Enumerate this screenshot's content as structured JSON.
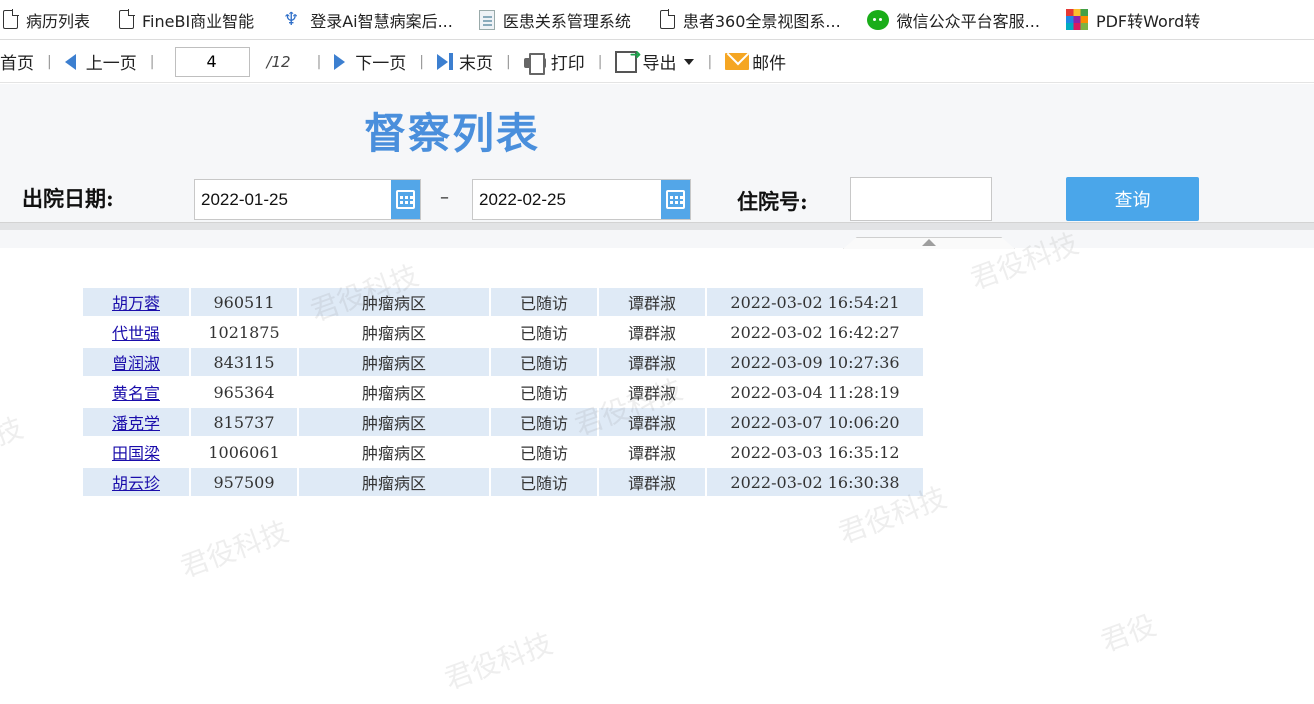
{
  "bookmarks": [
    {
      "label": "病历列表",
      "icon": "page-icon"
    },
    {
      "label": "FineBI商业智能",
      "icon": "page-icon"
    },
    {
      "label": "登录Ai智慧病案后...",
      "icon": "lotus-icon"
    },
    {
      "label": "医患关系管理系统",
      "icon": "doc-icon"
    },
    {
      "label": "患者360全景视图系...",
      "icon": "page-icon"
    },
    {
      "label": "微信公众平台客服...",
      "icon": "wechat-icon"
    },
    {
      "label": "PDF转Word转",
      "icon": "pdf-icon"
    }
  ],
  "toolbar": {
    "first": "首页",
    "prev": "上一页",
    "page_value": "4",
    "page_total": "/12",
    "next": "下一页",
    "last": "末页",
    "print": "打印",
    "export": "导出",
    "mail": "邮件"
  },
  "filter": {
    "title": "督察列表",
    "discharge_label": "出院日期:",
    "date_from": "2022-01-25",
    "date_sep": "–",
    "date_to": "2022-02-25",
    "admission_label": "住院号:",
    "admission_value": "",
    "query_label": "查询"
  },
  "table": {
    "rows": [
      [
        "胡万蓉",
        "960511",
        "肿瘤病区",
        "已随访",
        "谭群淑",
        "2022-03-02 16:54:21"
      ],
      [
        "代世强",
        "1021875",
        "肿瘤病区",
        "已随访",
        "谭群淑",
        "2022-03-02 16:42:27"
      ],
      [
        "曾润淑",
        "843115",
        "肿瘤病区",
        "已随访",
        "谭群淑",
        "2022-03-09 10:27:36"
      ],
      [
        "黄名宣",
        "965364",
        "肿瘤病区",
        "已随访",
        "谭群淑",
        "2022-03-04 11:28:19"
      ],
      [
        "潘克学",
        "815737",
        "肿瘤病区",
        "已随访",
        "谭群淑",
        "2022-03-07 10:06:20"
      ],
      [
        "田国梁",
        "1006061",
        "肿瘤病区",
        "已随访",
        "谭群淑",
        "2022-03-03 16:35:12"
      ],
      [
        "胡云珍",
        "957509",
        "肿瘤病区",
        "已随访",
        "谭群淑",
        "2022-03-02 16:30:38"
      ]
    ]
  },
  "watermarks": [
    "君役科技",
    "君役科技",
    "技",
    "君役科技",
    "君役科技",
    "君役科技",
    "君役科技",
    "君役"
  ],
  "colors": {
    "accent": "#4a8fdc",
    "button": "#4aa6ea",
    "row_alt": "#dfeaf6",
    "link": "#1a0dab"
  }
}
